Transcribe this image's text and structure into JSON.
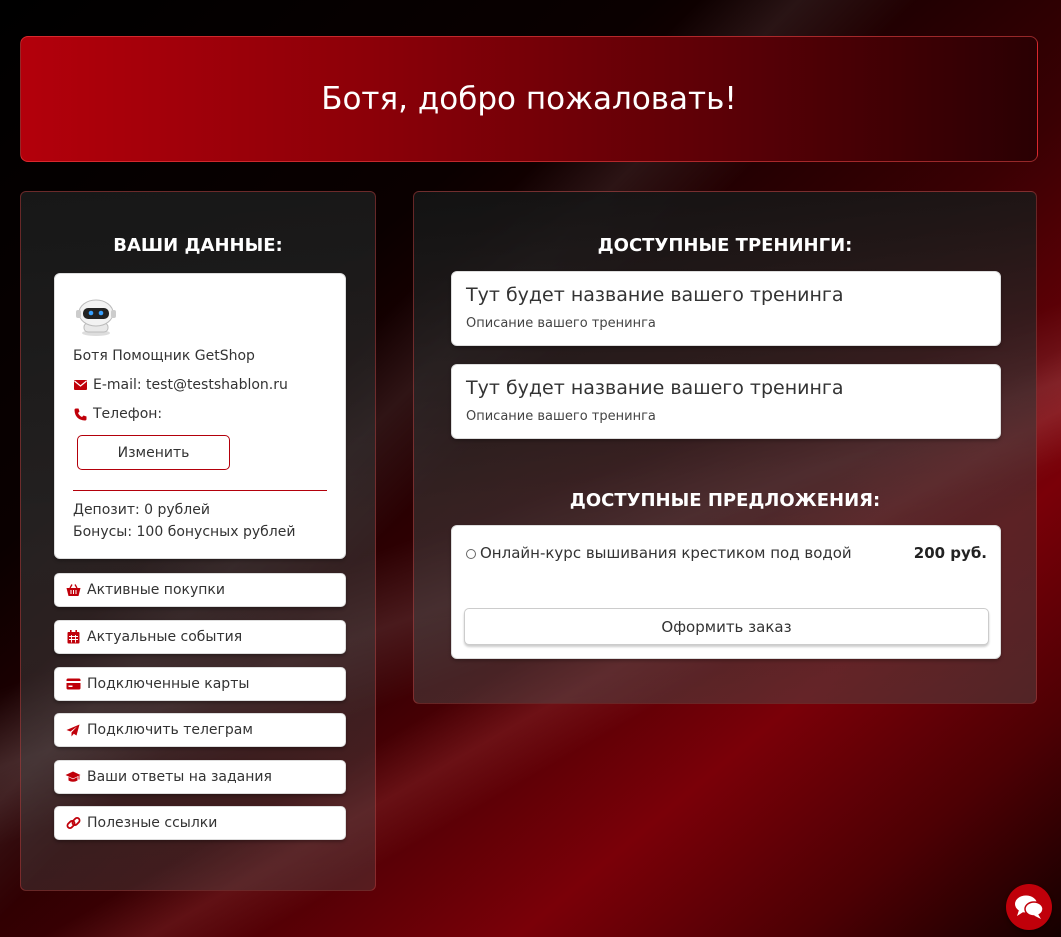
{
  "hero": {
    "title": "Ботя, добро пожаловать!"
  },
  "profile": {
    "section_title": "ВАШИ ДАННЫЕ:",
    "avatar_icon": "robot-avatar-icon",
    "name": "Ботя Помощник GetShop",
    "email_label": "E-mail: test@testshablon.ru",
    "phone_label": "Телефон:",
    "edit_button": "Изменить",
    "deposit": "Депозит: 0 рублей",
    "bonuses": "Бонусы: 100 бонусных рублей"
  },
  "menu": [
    {
      "label": "Активные покупки",
      "icon": "basket-icon"
    },
    {
      "label": "Актуальные события",
      "icon": "calendar-icon"
    },
    {
      "label": "Подключенные карты",
      "icon": "credit-card-icon"
    },
    {
      "label": "Подключить телеграм",
      "icon": "paper-plane-icon"
    },
    {
      "label": "Ваши ответы на задания",
      "icon": "graduation-cap-icon"
    },
    {
      "label": "Полезные ссылки",
      "icon": "link-icon"
    }
  ],
  "trainings": {
    "section_title": "ДОСТУПНЫЕ ТРЕНИНГИ:",
    "items": [
      {
        "title": "Тут будет название вашего тренинга",
        "description": "Описание вашего тренинга"
      },
      {
        "title": "Тут будет название вашего тренинга",
        "description": "Описание вашего тренинга"
      }
    ]
  },
  "offers": {
    "section_title": "ДОСТУПНЫЕ ПРЕДЛОЖЕНИЯ:",
    "items": [
      {
        "name": "Онлайн-курс вышивания крестиком под водой",
        "price": "200 руб."
      }
    ],
    "order_button": "Оформить заказ"
  },
  "colors": {
    "accent": "#c0000a",
    "hero_start": "#b3000b",
    "hero_end": "#2a0003"
  },
  "chat": {
    "icon": "chat-bubbles-icon"
  }
}
